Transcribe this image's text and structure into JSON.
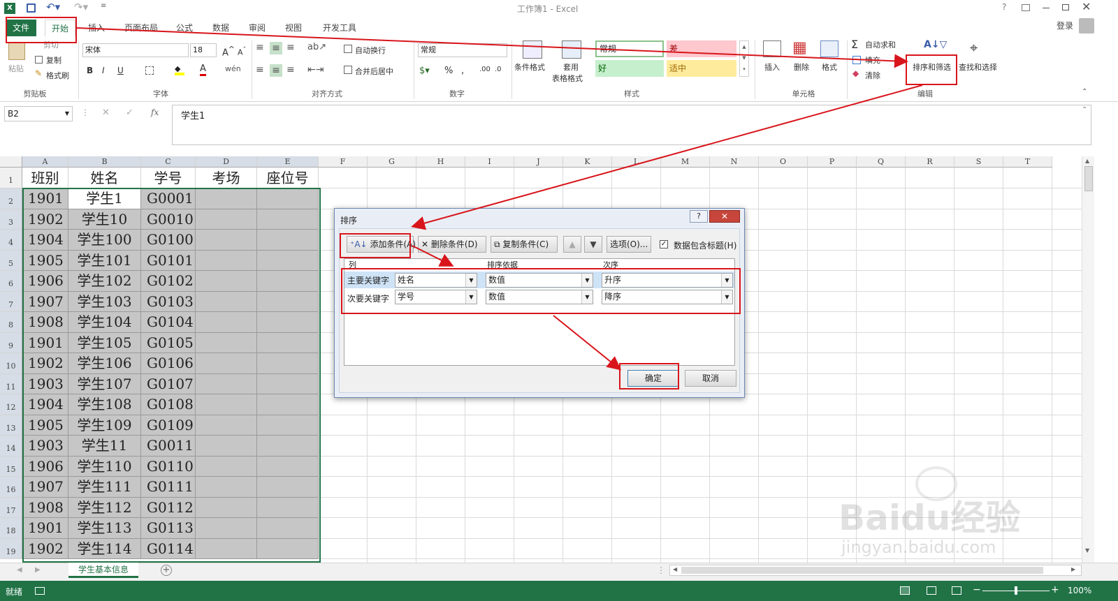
{
  "title": "工作簿1 - Excel",
  "login": "登录",
  "tabs": [
    "文件",
    "开始",
    "插入",
    "页面布局",
    "公式",
    "数据",
    "审阅",
    "视图",
    "开发工具"
  ],
  "clipboard": {
    "paste": "粘贴",
    "cut": "剪切",
    "copy": "复制",
    "painter": "格式刷",
    "group": "剪贴板"
  },
  "font": {
    "name": "宋体",
    "size": "18",
    "group": "字体"
  },
  "align": {
    "wrap": "自动换行",
    "merge": "合并后居中",
    "group": "对齐方式"
  },
  "number": {
    "format": "常规",
    "group": "数字"
  },
  "styles": {
    "cond": "条件格式",
    "table1": "套用",
    "table2": "表格格式",
    "normal": "常规",
    "bad": "差",
    "good": "好",
    "neutral": "适中",
    "group": "样式"
  },
  "cells": {
    "insert": "插入",
    "delete": "删除",
    "format": "格式",
    "group": "单元格"
  },
  "editing": {
    "autosum": "自动求和",
    "fill": "填充",
    "clear": "清除",
    "sort": "排序和筛选",
    "find": "查找和选择",
    "group": "编辑"
  },
  "formula": {
    "namebox": "B2",
    "fx": "fx",
    "value": "学生1"
  },
  "columns": [
    "A",
    "B",
    "C",
    "D",
    "E",
    "F",
    "G",
    "H",
    "I",
    "J",
    "K",
    "L",
    "M",
    "N",
    "O",
    "P",
    "Q",
    "R",
    "S",
    "T"
  ],
  "rows": [
    [
      "班别",
      "姓名",
      "学号",
      "考场",
      "座位号"
    ],
    [
      "1901",
      "学生1",
      "G0001",
      "",
      ""
    ],
    [
      "1902",
      "学生10",
      "G0010",
      "",
      ""
    ],
    [
      "1904",
      "学生100",
      "G0100",
      "",
      ""
    ],
    [
      "1905",
      "学生101",
      "G0101",
      "",
      ""
    ],
    [
      "1906",
      "学生102",
      "G0102",
      "",
      ""
    ],
    [
      "1907",
      "学生103",
      "G0103",
      "",
      ""
    ],
    [
      "1908",
      "学生104",
      "G0104",
      "",
      ""
    ],
    [
      "1901",
      "学生105",
      "G0105",
      "",
      ""
    ],
    [
      "1902",
      "学生106",
      "G0106",
      "",
      ""
    ],
    [
      "1903",
      "学生107",
      "G0107",
      "",
      ""
    ],
    [
      "1904",
      "学生108",
      "G0108",
      "",
      ""
    ],
    [
      "1905",
      "学生109",
      "G0109",
      "",
      ""
    ],
    [
      "1903",
      "学生11",
      "G0011",
      "",
      ""
    ],
    [
      "1906",
      "学生110",
      "G0110",
      "",
      ""
    ],
    [
      "1907",
      "学生111",
      "G0111",
      "",
      ""
    ],
    [
      "1908",
      "学生112",
      "G0112",
      "",
      ""
    ],
    [
      "1901",
      "学生113",
      "G0113",
      "",
      ""
    ],
    [
      "1902",
      "学生114",
      "G0114",
      "",
      ""
    ]
  ],
  "dialog": {
    "title": "排序",
    "add": "添加条件(A)",
    "remove": "删除条件(D)",
    "copy": "复制条件(C)",
    "options": "选项(O)...",
    "header": "数据包含标题(H)",
    "col_header": "列",
    "basis_header": "排序依据",
    "order_header": "次序",
    "rules": [
      {
        "label": "主要关键字",
        "column": "姓名",
        "basis": "数值",
        "order": "升序"
      },
      {
        "label": "次要关键字",
        "column": "学号",
        "basis": "数值",
        "order": "降序"
      }
    ],
    "ok": "确定",
    "cancel": "取消"
  },
  "sheet_tab": "学生基本信息",
  "status": {
    "ready": "就绪",
    "zoom": "100%"
  },
  "watermark": {
    "brand": "Baidu经验",
    "url": "jingyan.baidu.com"
  },
  "colors": {
    "green": "#217346",
    "red": "#d8151b",
    "good": "#c6efce",
    "bad": "#ffc7ce",
    "neutral": "#ffeb9c"
  }
}
